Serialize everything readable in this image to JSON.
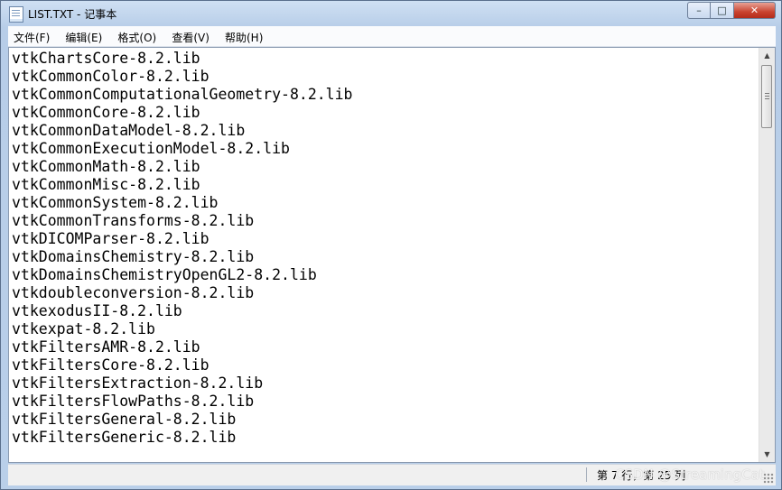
{
  "window": {
    "title": "LIST.TXT - 记事本"
  },
  "caption": {
    "minimize": "–",
    "maximize": "□",
    "close": "✕"
  },
  "menu": [
    "文件(F)",
    "编辑(E)",
    "格式(O)",
    "查看(V)",
    "帮助(H)"
  ],
  "lines": [
    "vtkChartsCore-8.2.lib",
    "vtkCommonColor-8.2.lib",
    "vtkCommonComputationalGeometry-8.2.lib",
    "vtkCommonCore-8.2.lib",
    "vtkCommonDataModel-8.2.lib",
    "vtkCommonExecutionModel-8.2.lib",
    "vtkCommonMath-8.2.lib",
    "vtkCommonMisc-8.2.lib",
    "vtkCommonSystem-8.2.lib",
    "vtkCommonTransforms-8.2.lib",
    "vtkDICOMParser-8.2.lib",
    "vtkDomainsChemistry-8.2.lib",
    "vtkDomainsChemistryOpenGL2-8.2.lib",
    "vtkdoubleconversion-8.2.lib",
    "vtkexodusII-8.2.lib",
    "vtkexpat-8.2.lib",
    "vtkFiltersAMR-8.2.lib",
    "vtkFiltersCore-8.2.lib",
    "vtkFiltersExtraction-8.2.lib",
    "vtkFiltersFlowPaths-8.2.lib",
    "vtkFiltersGeneral-8.2.lib",
    "vtkFiltersGeneric-8.2.lib"
  ],
  "status": {
    "position": "第 7 行，第 25 列",
    "watermark": "CSDN @StreamingCat."
  },
  "icons": {
    "app": "notepad-icon",
    "scroll_up": "arrow-up-icon",
    "scroll_down": "arrow-down-icon"
  },
  "colors": {
    "titlebar": "#b9cfe9",
    "close_button": "#c9432f"
  }
}
